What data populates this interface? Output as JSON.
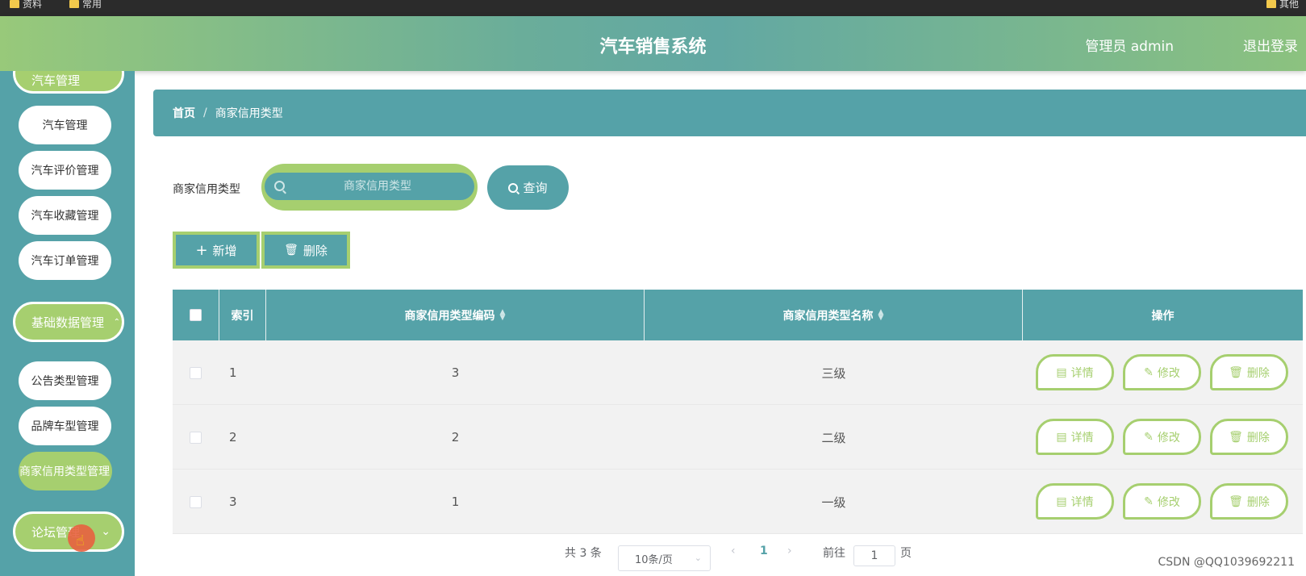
{
  "os_bar": {
    "items": [
      "资料",
      "常用",
      "其他"
    ]
  },
  "header": {
    "title": "汽车销售系统",
    "user": "管理员 admin",
    "logout": "退出登录"
  },
  "sidebar": {
    "top_partial": "汽车管理",
    "car_items": [
      "汽车管理",
      "汽车评价管理",
      "汽车收藏管理",
      "汽车订单管理"
    ],
    "group_base": "基础数据管理",
    "base_items": [
      "公告类型管理",
      "品牌车型管理",
      "商家信用类型管理"
    ],
    "group_forum": "论坛管理"
  },
  "breadcrumb": {
    "home": "首页",
    "sep": "/",
    "current": "商家信用类型"
  },
  "search": {
    "label": "商家信用类型",
    "placeholder": "商家信用类型",
    "button": "查询"
  },
  "actions": {
    "add": "新增",
    "delete": "删除"
  },
  "table": {
    "headers": {
      "index": "索引",
      "code": "商家信用类型编码",
      "name": "商家信用类型名称",
      "ops": "操作"
    },
    "rows": [
      {
        "index": "1",
        "code": "3",
        "name": "三级"
      },
      {
        "index": "2",
        "code": "2",
        "name": "二级"
      },
      {
        "index": "3",
        "code": "1",
        "name": "一级"
      }
    ],
    "row_actions": {
      "detail": "详情",
      "edit": "修改",
      "delete": "删除"
    }
  },
  "pagination": {
    "total": "共 3 条",
    "page_size": "10条/页",
    "current_page": "1",
    "goto_label": "前往",
    "goto_value": "1",
    "goto_suffix": "页"
  },
  "watermark": "CSDN @QQ1039692211",
  "colors": {
    "teal": "#55a2a8",
    "green": "#a6cf6f"
  }
}
